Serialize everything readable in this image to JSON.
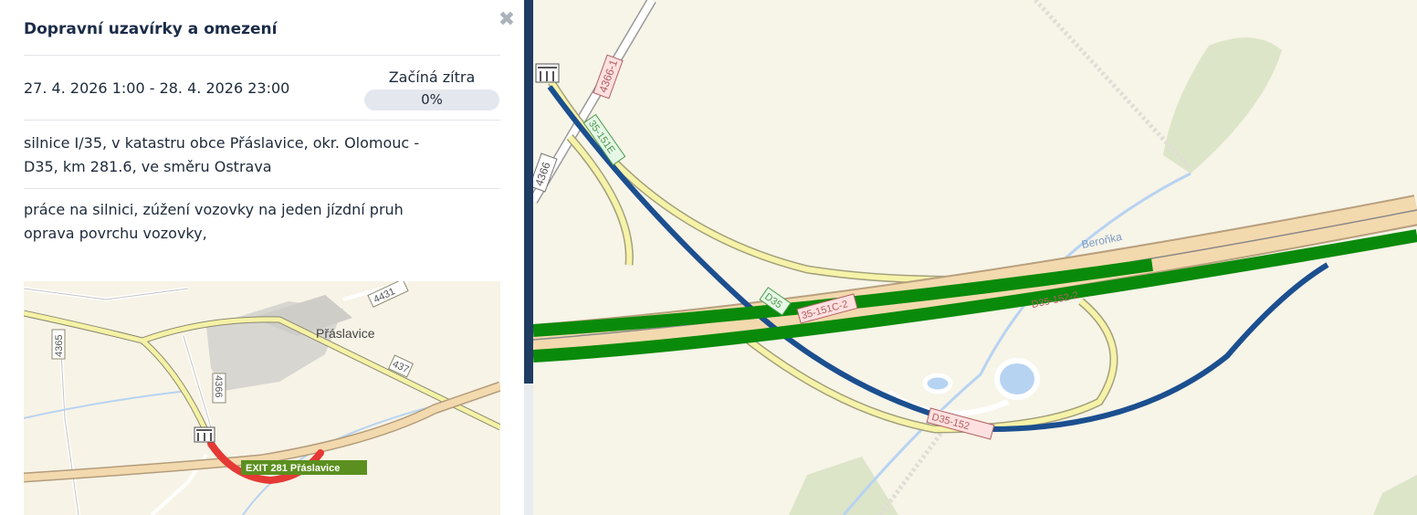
{
  "panel": {
    "title": "Dopravní uzavírky a omezení",
    "close_icon": "close-icon",
    "date_range": "27. 4. 2026 1:00 - 28. 4. 2026 23:00",
    "status": "Začíná zítra",
    "progress": {
      "percent": 0,
      "label": "0%"
    },
    "location_lines": [
      "silnice I/35, v katastru obce Přáslavice, okr. Olomouc -",
      "D35, km 281.6, ve směru Ostrava"
    ],
    "reason_lines": [
      "práce na silnici, zúžení vozovky na jeden jízdní pruh",
      "oprava povrchu vozovky,"
    ]
  },
  "mini_map": {
    "town": "Přáslavice",
    "exit_label": "EXIT 281 Přáslavice",
    "road_labels": [
      "4431",
      "437",
      "4366",
      "4365"
    ],
    "roadwork_icon": "roadwork-icon"
  },
  "main_map": {
    "river": "Beroňka",
    "road_labels": [
      "4366-1",
      "4366",
      "35-151E",
      "D35",
      "35-151C-2",
      "D35-152-2",
      "D35-152"
    ],
    "roadwork_icon": "roadwork-icon",
    "colors": {
      "closure": "#0a8a0a",
      "detour": "#1b4f8f",
      "minimap_closure": "#e53935"
    }
  }
}
